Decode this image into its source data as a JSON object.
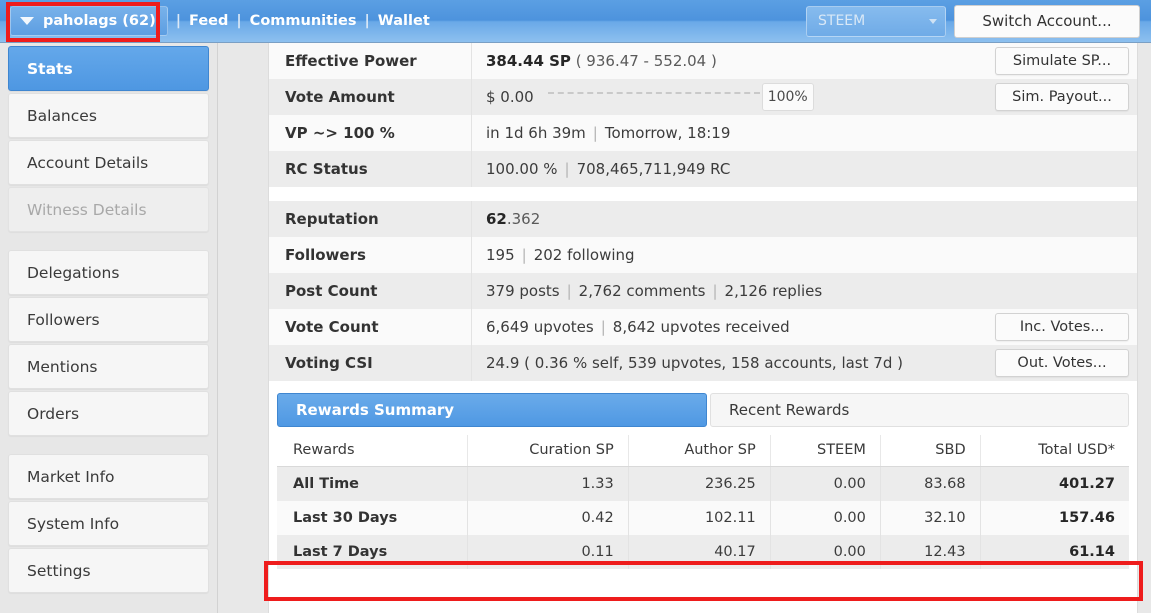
{
  "header": {
    "account_label": "paholags (62)",
    "caret_icon": "chevron-down-icon",
    "nav": [
      {
        "label": "Feed"
      },
      {
        "label": "Communities"
      },
      {
        "label": "Wallet"
      }
    ],
    "separator": "|",
    "chain_selected": "STEEM",
    "chain_caret_icon": "chevron-down-icon",
    "switch_account_label": "Switch Account..."
  },
  "sidebar": {
    "items": [
      {
        "label": "Stats",
        "state": "active"
      },
      {
        "label": "Balances",
        "state": "normal"
      },
      {
        "label": "Account Details",
        "state": "normal"
      },
      {
        "label": "Witness Details",
        "state": "disabled"
      },
      {
        "label": "Delegations",
        "state": "normal"
      },
      {
        "label": "Followers",
        "state": "normal"
      },
      {
        "label": "Mentions",
        "state": "normal"
      },
      {
        "label": "Orders",
        "state": "normal"
      },
      {
        "label": "Market Info",
        "state": "normal"
      },
      {
        "label": "System Info",
        "state": "normal"
      },
      {
        "label": "Settings",
        "state": "normal"
      }
    ]
  },
  "stats": {
    "effective_power": {
      "label": "Effective Power",
      "value_strong": "384.44 SP",
      "value_rest": "( 936.47 - 552.04 )",
      "button": "Simulate SP..."
    },
    "vote_amount": {
      "label": "Vote Amount",
      "amount": "$ 0.00",
      "percent": "100%",
      "button": "Sim. Payout..."
    },
    "vp_recharge": {
      "label": "VP ~> 100 %",
      "eta": "in 1d 6h 39m",
      "when": "Tomorrow, 18:19"
    },
    "rc_status": {
      "label": "RC Status",
      "percent": "100.00 %",
      "amount": "708,465,711,949 RC"
    },
    "reputation": {
      "label": "Reputation",
      "value_strong": "62",
      "value_rest": ".362"
    },
    "followers": {
      "label": "Followers",
      "count": "195",
      "following": "202 following"
    },
    "post_count": {
      "label": "Post Count",
      "posts": "379 posts",
      "comments": "2,762 comments",
      "replies": "2,126 replies"
    },
    "vote_count": {
      "label": "Vote Count",
      "given": "6,649 upvotes",
      "received": "8,642 upvotes received",
      "button": "Inc. Votes..."
    },
    "voting_csi": {
      "label": "Voting CSI",
      "value": "24.9 ( 0.36 % self, 539 upvotes, 158 accounts, last 7d )",
      "button": "Out. Votes..."
    }
  },
  "rewards": {
    "tabs": [
      {
        "label": "Rewards Summary",
        "active": true
      },
      {
        "label": "Recent Rewards",
        "active": false
      }
    ],
    "columns": [
      "Rewards",
      "Curation SP",
      "Author SP",
      "STEEM",
      "SBD",
      "Total USD*"
    ],
    "rows": [
      {
        "period": "All Time",
        "curation_sp": "1.33",
        "author_sp": "236.25",
        "steem": "0.00",
        "sbd": "83.68",
        "total_usd": "401.27"
      },
      {
        "period": "Last 30 Days",
        "curation_sp": "0.42",
        "author_sp": "102.11",
        "steem": "0.00",
        "sbd": "32.10",
        "total_usd": "157.46"
      },
      {
        "period": "Last 7 Days",
        "curation_sp": "0.11",
        "author_sp": "40.17",
        "steem": "0.00",
        "sbd": "12.43",
        "total_usd": "61.14"
      }
    ]
  },
  "annotations": {
    "highlight_color": "#ee1c1c"
  }
}
